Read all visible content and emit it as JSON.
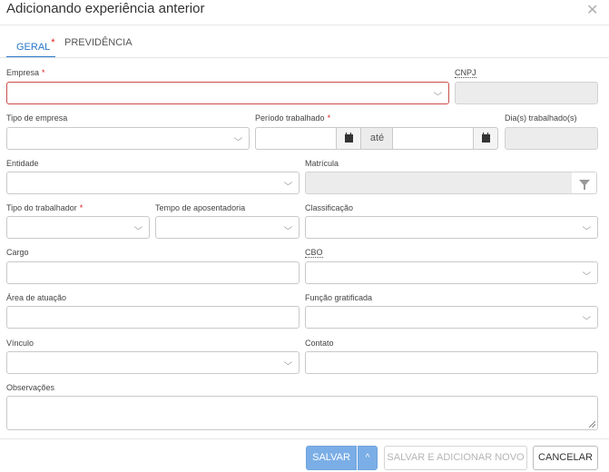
{
  "dialog": {
    "title": "Adicionando experiência anterior",
    "close_glyph": "✕"
  },
  "tabs": [
    {
      "label": "GERAL",
      "required": "*"
    },
    {
      "label": "PREVIDÊNCIA"
    }
  ],
  "required_mark": "*",
  "form": {
    "empresa": {
      "label": "Empresa",
      "value": ""
    },
    "cnpj": {
      "label": "CNPJ",
      "value": ""
    },
    "tipo_empresa": {
      "label": "Tipo de empresa",
      "value": ""
    },
    "periodo": {
      "label": "Período trabalhado",
      "separator": "até",
      "start": "",
      "end": ""
    },
    "dias": {
      "label": "Dia(s) trabalhado(s)",
      "value": ""
    },
    "entidade": {
      "label": "Entidade",
      "value": ""
    },
    "matricula": {
      "label": "Matrícula",
      "value": ""
    },
    "tipo_trabalhador": {
      "label": "Tipo do trabalhador",
      "value": ""
    },
    "tempo_aposentadoria": {
      "label": "Tempo de aposentadoria",
      "value": ""
    },
    "classificacao": {
      "label": "Classificação",
      "value": ""
    },
    "cargo": {
      "label": "Cargo",
      "value": ""
    },
    "cbo": {
      "label": "CBO",
      "value": ""
    },
    "area_atuacao": {
      "label": "Área de atuação",
      "value": ""
    },
    "funcao_gratificada": {
      "label": "Função gratificada",
      "value": ""
    },
    "vinculo": {
      "label": "Vínculo",
      "value": ""
    },
    "contato": {
      "label": "Contato",
      "value": ""
    },
    "observacoes": {
      "label": "Observações",
      "value": ""
    }
  },
  "icons": {
    "chevron": "⌵",
    "calendar": "calendar-icon",
    "filter": "filter-icon",
    "chevron_up": "^"
  },
  "footer": {
    "save": "SALVAR",
    "save_and_new": "SALVAR E ADICIONAR NOVO",
    "cancel": "CANCELAR"
  },
  "colors": {
    "accent": "#2a78c8",
    "required": "#e02020",
    "error_border": "#c9504b",
    "primary_button": "#7baee6"
  }
}
